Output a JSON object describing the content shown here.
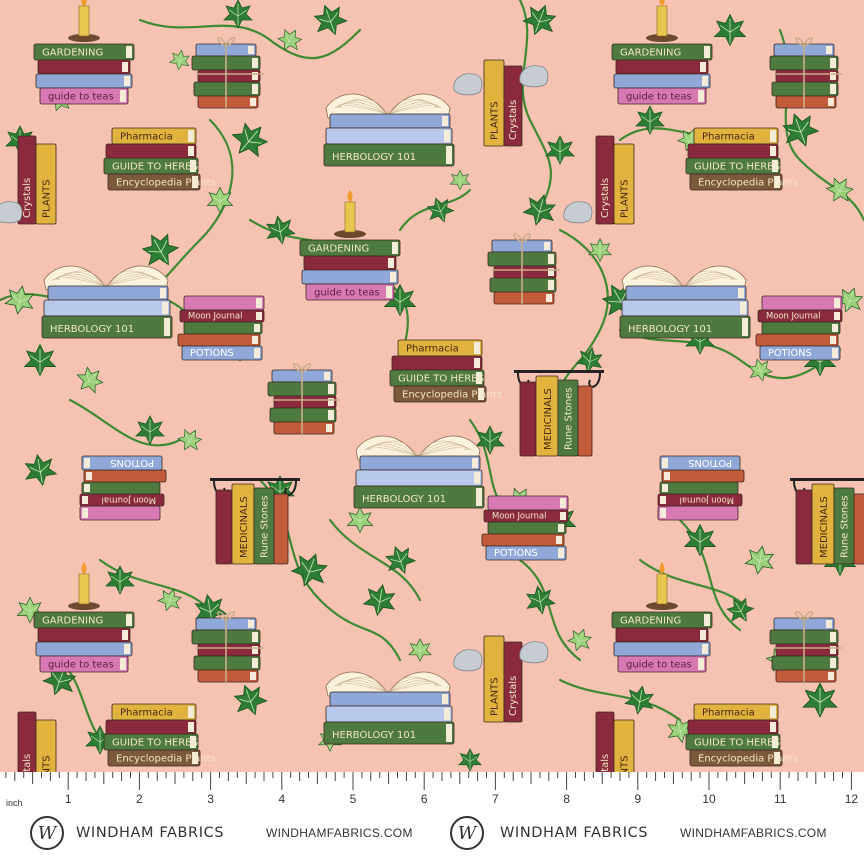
{
  "colors": {
    "background": "#f6c2b2",
    "ivy_dark": "#2e7d34",
    "ivy_light": "#9bd07a",
    "book_green": "#4f7a3f",
    "book_burgundy": "#8a2a3c",
    "book_blue": "#8fa8d8",
    "book_mustard": "#e0b23e",
    "book_pink": "#d879b4"
  },
  "book_titles": {
    "gardening": "GARDENING",
    "guide_to_teas": "guide to teas",
    "herbology": "HERBOLOGY 101",
    "potions": "POTIONS",
    "plants": "PLANTS",
    "crystals": "Crystals",
    "pharmacia": "Pharmacia",
    "guide_to_herbs": "GUIDE TO HERBS",
    "encyclopedia": "Encyclopedia Plants",
    "moon_journal": "Moon Journal",
    "medicinals": "MEDICINALS",
    "rune_stones": "Rune Stones"
  },
  "ruler": {
    "unit": "inch",
    "numbers": [
      "1",
      "2",
      "3",
      "4",
      "5",
      "6",
      "7",
      "8",
      "9",
      "10",
      "11",
      "12"
    ]
  },
  "brand": {
    "monogram": "W",
    "name": "WINDHAM FABRICS",
    "url": "WINDHAMFABRICS.COM"
  }
}
